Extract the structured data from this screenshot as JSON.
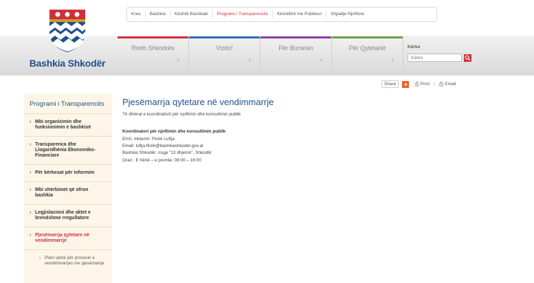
{
  "logo": {
    "text": "Bashkia Shkodër"
  },
  "top_nav": [
    {
      "label": "Kreu"
    },
    {
      "label": "Bashkia"
    },
    {
      "label": "Këshilli Bashkiak"
    },
    {
      "label": "Programi i Transparencës",
      "active": true
    },
    {
      "label": "Këshillimi me Publikun"
    },
    {
      "label": "Shpallje Njoftime"
    }
  ],
  "main_nav": [
    {
      "label": "Rreth Shkodrës",
      "color": "#d12e3d"
    },
    {
      "label": "Vizito!",
      "color": "#2f6db5"
    },
    {
      "label": "Për Biznesin",
      "color": "#8b3fa0"
    },
    {
      "label": "Për Qytetarët",
      "color": "#6aa23c"
    }
  ],
  "search": {
    "label": "Kërko",
    "placeholder": "Kërko"
  },
  "share_bar": {
    "share_label": "Share",
    "print_label": "Print",
    "separator": "|",
    "email_label": "Email"
  },
  "sidebar": {
    "title": "Programi i Transparencës",
    "items": [
      {
        "label": "Mbi organizimin dhe funksionimin e bashkisë"
      },
      {
        "label": "Transparenca dhe Llogaridhënia Ekonomiko-Financiare"
      },
      {
        "label": "Për kërkesat për informim"
      },
      {
        "label": "Mbi shërbimet që ofron bashkia"
      },
      {
        "label": "Legjislacioni dhe aktet e brendshme rregullatore"
      },
      {
        "label": "Pjesëmarrja qytetare në vendimmarrje",
        "active": true
      }
    ],
    "sub_items": [
      {
        "label": "Plani vjetor për procesin e vendimmarrjes me pjesëmarrje"
      }
    ]
  },
  "content": {
    "title": "Pjesëmarrja qytetare në vendimmarrje",
    "intro": "Të dhënat e koordinatorit për njoftimin dhe konsultimin publik",
    "coordinator_heading": "Koordinatori për njoftimin dhe konsultimin publik",
    "lines": [
      "Emri, mbiemri: Florik Luftja",
      "Email: luftja.florik@bashkiashkoder.gov.al",
      "Bashkia Shkodër, rruga \"13 dhjetori\", Shkodër",
      "Orari : E hënë – e premte, 08:00 – 16:00"
    ]
  },
  "colors": {
    "accent_red": "#d12e3d",
    "brand_blue": "#1f4f8c",
    "share_orange": "#e8612c",
    "sidebar_bg": "#fdf6e8"
  }
}
